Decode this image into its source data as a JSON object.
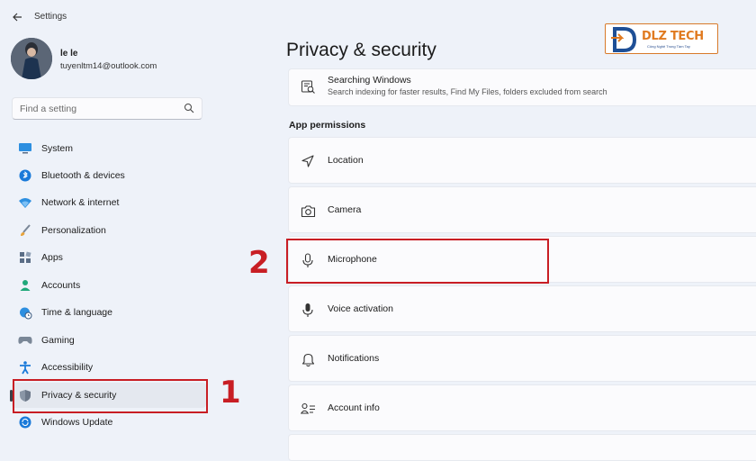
{
  "window": {
    "title": "Settings"
  },
  "user": {
    "name": "le le",
    "email": "tuyenltm14@outlook.com"
  },
  "search": {
    "placeholder": "Find a setting"
  },
  "sidebar": {
    "items": [
      {
        "label": "System",
        "icon": "monitor-icon"
      },
      {
        "label": "Bluetooth & devices",
        "icon": "bluetooth-icon"
      },
      {
        "label": "Network & internet",
        "icon": "wifi-icon"
      },
      {
        "label": "Personalization",
        "icon": "brush-icon"
      },
      {
        "label": "Apps",
        "icon": "apps-icon"
      },
      {
        "label": "Accounts",
        "icon": "person-icon"
      },
      {
        "label": "Time & language",
        "icon": "globe-clock-icon"
      },
      {
        "label": "Gaming",
        "icon": "gamepad-icon"
      },
      {
        "label": "Accessibility",
        "icon": "accessibility-icon"
      },
      {
        "label": "Privacy & security",
        "icon": "shield-icon",
        "active": true
      },
      {
        "label": "Windows Update",
        "icon": "update-icon"
      }
    ]
  },
  "page": {
    "title": "Privacy & security"
  },
  "searching_windows": {
    "label": "Searching Windows",
    "description": "Search indexing for faster results, Find My Files, folders excluded from search"
  },
  "app_permissions": {
    "title": "App permissions",
    "items": [
      {
        "label": "Location",
        "icon": "location-arrow-icon"
      },
      {
        "label": "Camera",
        "icon": "camera-icon"
      },
      {
        "label": "Microphone",
        "icon": "microphone-icon"
      },
      {
        "label": "Voice activation",
        "icon": "voice-mic-icon"
      },
      {
        "label": "Notifications",
        "icon": "bell-icon"
      },
      {
        "label": "Account info",
        "icon": "account-info-icon"
      }
    ]
  },
  "annotations": {
    "step1": "1",
    "step2": "2"
  },
  "logo": {
    "text": "DLZ TECH",
    "tagline": "Công Nghệ Trong Tầm Tay"
  },
  "colors": {
    "highlight_red": "#c81e24",
    "accent_blue": "#0067c0",
    "logo_orange": "#e07a20"
  }
}
